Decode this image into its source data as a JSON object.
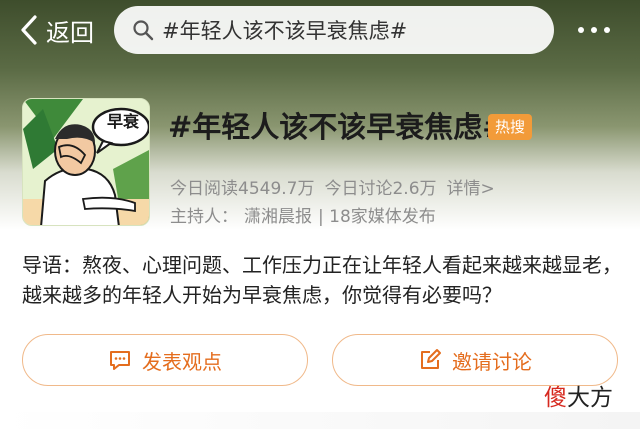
{
  "nav": {
    "back_label": "返回",
    "search_query": "#年轻人该不该早衰焦虑#"
  },
  "topic": {
    "thumbnail_bubble": "早衰",
    "title": "#年轻人该不该早衰焦虑#",
    "hot_badge": "热搜",
    "reads": "今日阅读4549.7万",
    "discussions": "今日讨论2.6万",
    "details_link": "详情>",
    "host_label": "主持人：",
    "host_name": "潇湘晨报",
    "media_count": "| 18家媒体发布"
  },
  "intro": {
    "text": "导语：熬夜、心理问题、工作压力正在让年轻人看起来越来越显老，越来越多的年轻人开始为早衰焦虑，你觉得有必要吗？"
  },
  "actions": {
    "post_label": "发表观点",
    "invite_label": "邀请讨论"
  },
  "watermark": {
    "first_char": "傻",
    "rest": "大方"
  },
  "colors": {
    "accent": "#e46d1e",
    "hot_badge": "#f29b39",
    "watermark_red": "#d6281e"
  }
}
